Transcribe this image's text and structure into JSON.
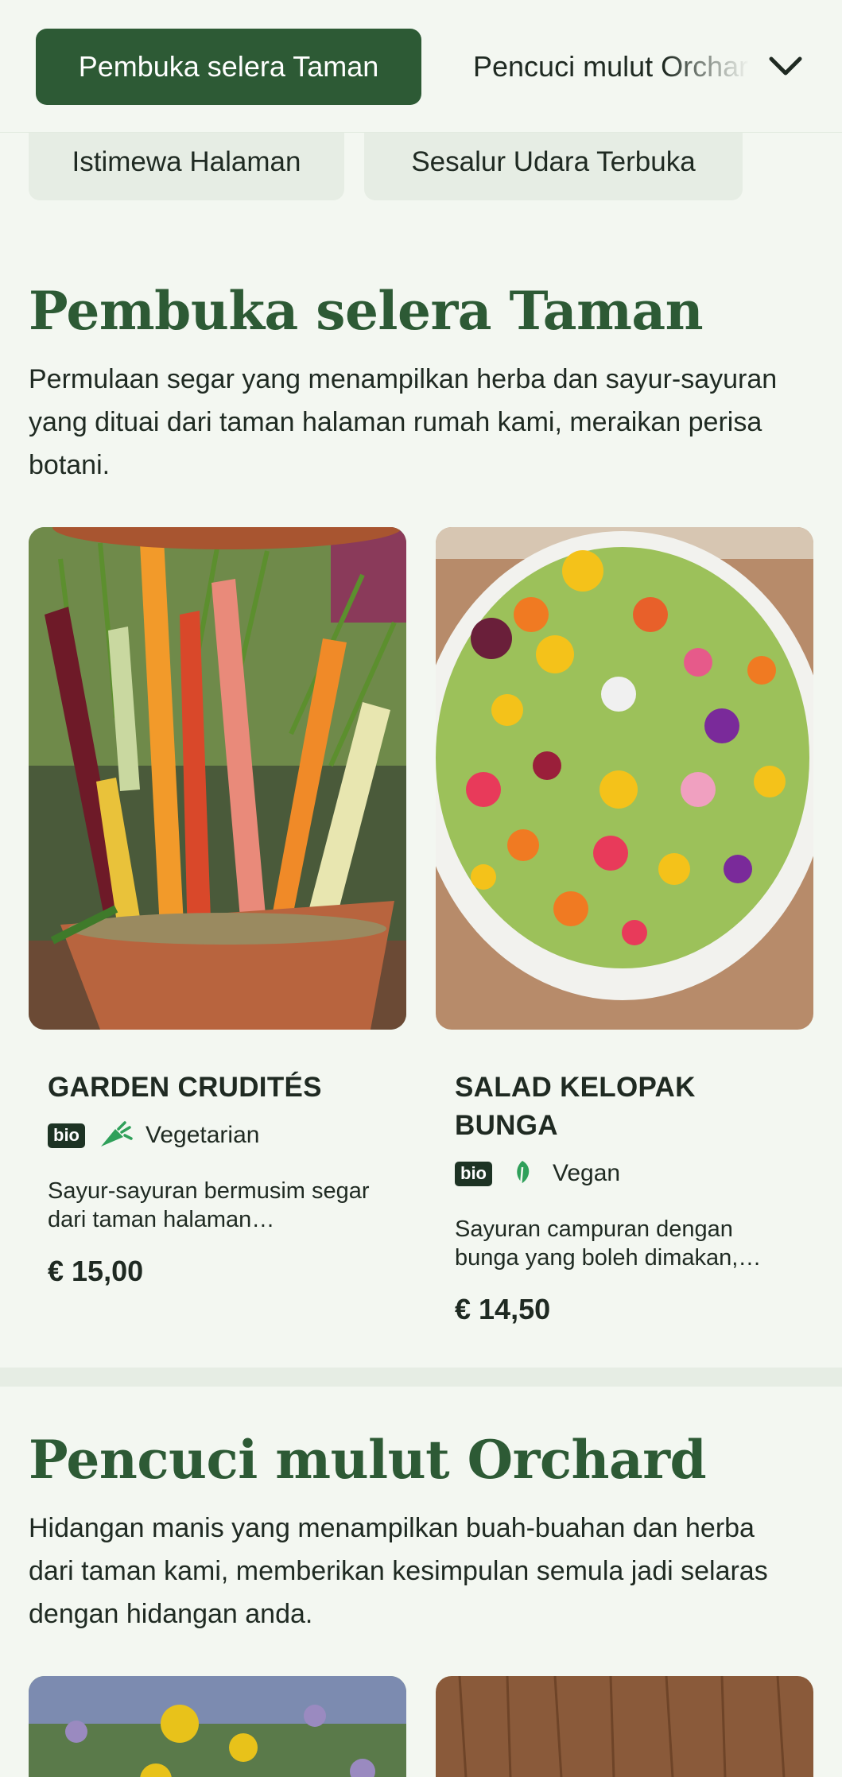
{
  "nav": {
    "active_label": "Pembuka selera Taman",
    "second_label": "Pencuci mulut Orchard",
    "chevron_icon": "chevron-down-icon"
  },
  "subnav": {
    "chips": [
      "Istimewa Halaman",
      "Sesalur Udara Terbuka"
    ]
  },
  "sections": [
    {
      "title": "Pembuka selera Taman",
      "description": "Permulaan segar yang menampilkan herba dan sayur-sayuran yang dituai dari taman halaman rumah kami, meraikan perisa botani.",
      "items": [
        {
          "name": "GARDEN CRUDITÉS",
          "badge": "bio",
          "diet": "Vegetarian",
          "diet_icon": "carrot-icon",
          "description": "Sayur-sayuran bermusim segar dari taman halaman…",
          "price": "€ 15,00",
          "image": "potted-carrots-photo"
        },
        {
          "name": "SALAD KELOPAK BUNGA",
          "badge": "bio",
          "diet": "Vegan",
          "diet_icon": "leaf-icon",
          "description": "Sayuran campuran dengan bunga yang boleh dimakan,…",
          "price": "€ 14,50",
          "image": "flower-salad-photo"
        }
      ]
    },
    {
      "title": "Pencuci mulut Orchard",
      "description": "Hidangan manis yang menampilkan buah-buahan dan herba dari taman kami, memberikan kesimpulan semula jadi selaras dengan hidangan anda."
    }
  ],
  "colors": {
    "background": "#f3f7f1",
    "brand_green": "#2d5a35",
    "chip_bg": "#e6ede4",
    "badge_bg": "#1d3324",
    "diet_icon_green": "#2fa05a"
  }
}
